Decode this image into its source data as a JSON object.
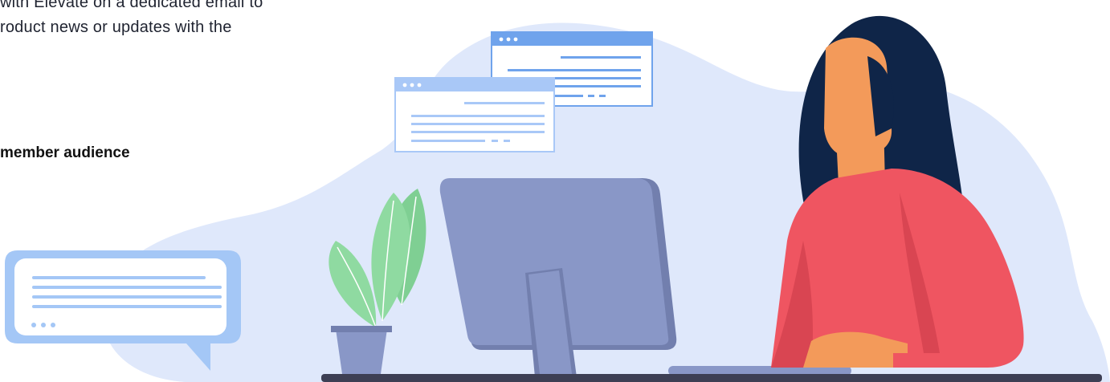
{
  "intro": {
    "lines": [
      "with Elevate on a dedicated email to",
      "roduct news or updates with the"
    ]
  },
  "section_heading": "member audience",
  "palette": {
    "backdrop": "#dfe8fb",
    "window_header": "#6fa3ec",
    "window_header_light": "#a9c8f7",
    "chat_bubble": "#a4c7f6",
    "monitor": "#8997c7",
    "monitor_dark": "#727fae",
    "sweater": "#ef5561",
    "skin": "#f39a5a",
    "hair": "#0f2548",
    "leaf": "#8fdaa1",
    "desk": "#3d3f54"
  }
}
